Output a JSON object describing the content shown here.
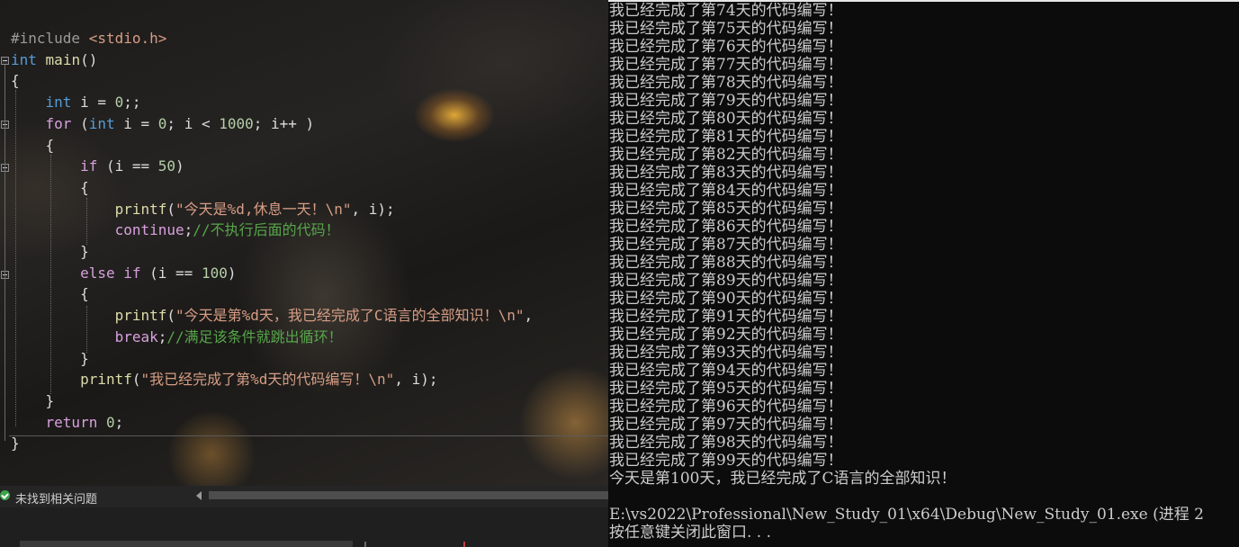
{
  "editor": {
    "lines": [
      [
        {
          "t": "#include ",
          "c": "pp"
        },
        {
          "t": "<stdio.h>",
          "c": "str"
        }
      ],
      [
        {
          "t": "int",
          "c": "kw"
        },
        {
          "t": " ",
          "c": "pl"
        },
        {
          "t": "main",
          "c": "fn"
        },
        {
          "t": "()",
          "c": "pl"
        }
      ],
      [
        {
          "t": "{",
          "c": "pl"
        }
      ],
      [
        {
          "t": "    ",
          "c": "pl"
        },
        {
          "t": "int",
          "c": "kw"
        },
        {
          "t": " i = ",
          "c": "pl"
        },
        {
          "t": "0",
          "c": "num"
        },
        {
          "t": ";;",
          "c": "pl"
        }
      ],
      [
        {
          "t": "    ",
          "c": "pl"
        },
        {
          "t": "for",
          "c": "ctl"
        },
        {
          "t": " (",
          "c": "pl"
        },
        {
          "t": "int",
          "c": "kw"
        },
        {
          "t": " i = ",
          "c": "pl"
        },
        {
          "t": "0",
          "c": "num"
        },
        {
          "t": "; i < ",
          "c": "pl"
        },
        {
          "t": "1000",
          "c": "num"
        },
        {
          "t": "; i++ )",
          "c": "pl"
        }
      ],
      [
        {
          "t": "    {",
          "c": "pl"
        }
      ],
      [
        {
          "t": "        ",
          "c": "pl"
        },
        {
          "t": "if",
          "c": "ctl"
        },
        {
          "t": " (i == ",
          "c": "pl"
        },
        {
          "t": "50",
          "c": "num"
        },
        {
          "t": ")",
          "c": "pl"
        }
      ],
      [
        {
          "t": "        {",
          "c": "pl"
        }
      ],
      [
        {
          "t": "            ",
          "c": "pl"
        },
        {
          "t": "printf",
          "c": "fn"
        },
        {
          "t": "(",
          "c": "pl"
        },
        {
          "t": "\"今天是%d,休息一天！\\n\"",
          "c": "str"
        },
        {
          "t": ", i);",
          "c": "pl"
        }
      ],
      [
        {
          "t": "            ",
          "c": "pl"
        },
        {
          "t": "continue",
          "c": "ctl"
        },
        {
          "t": ";",
          "c": "pl"
        },
        {
          "t": "//不执行后面的代码！",
          "c": "cm"
        }
      ],
      [
        {
          "t": "        }",
          "c": "pl"
        }
      ],
      [
        {
          "t": "        ",
          "c": "pl"
        },
        {
          "t": "else if",
          "c": "ctl"
        },
        {
          "t": " (i == ",
          "c": "pl"
        },
        {
          "t": "100",
          "c": "num"
        },
        {
          "t": ")",
          "c": "pl"
        }
      ],
      [
        {
          "t": "        {",
          "c": "pl"
        }
      ],
      [
        {
          "t": "            ",
          "c": "pl"
        },
        {
          "t": "printf",
          "c": "fn"
        },
        {
          "t": "(",
          "c": "pl"
        },
        {
          "t": "\"今天是第%d天，我已经完成了C语言的全部知识！\\n\"",
          "c": "str"
        },
        {
          "t": ",",
          "c": "pl"
        }
      ],
      [
        {
          "t": "            ",
          "c": "pl"
        },
        {
          "t": "break",
          "c": "ctl"
        },
        {
          "t": ";",
          "c": "pl"
        },
        {
          "t": "//满足该条件就跳出循环！",
          "c": "cm"
        }
      ],
      [
        {
          "t": "        }",
          "c": "pl"
        }
      ],
      [
        {
          "t": "        ",
          "c": "pl"
        },
        {
          "t": "printf",
          "c": "fn"
        },
        {
          "t": "(",
          "c": "pl"
        },
        {
          "t": "\"我已经完成了第%d天的代码编写！\\n\"",
          "c": "str"
        },
        {
          "t": ", i);",
          "c": "pl"
        }
      ],
      [
        {
          "t": "    }",
          "c": "pl"
        }
      ],
      [
        {
          "t": "    ",
          "c": "pl"
        },
        {
          "t": "return",
          "c": "ctl"
        },
        {
          "t": " ",
          "c": "pl"
        },
        {
          "t": "0",
          "c": "num"
        },
        {
          "t": ";",
          "c": "pl"
        }
      ],
      [
        {
          "t": "}",
          "c": "pl"
        }
      ]
    ]
  },
  "status_bar": {
    "message": "未找到相关问题",
    "status_icon": "check-circle-icon",
    "status_color": "#3fa34d"
  },
  "console": {
    "lines": [
      "我已经完成了第74天的代码编写！",
      "我已经完成了第75天的代码编写！",
      "我已经完成了第76天的代码编写！",
      "我已经完成了第77天的代码编写！",
      "我已经完成了第78天的代码编写！",
      "我已经完成了第79天的代码编写！",
      "我已经完成了第80天的代码编写！",
      "我已经完成了第81天的代码编写！",
      "我已经完成了第82天的代码编写！",
      "我已经完成了第83天的代码编写！",
      "我已经完成了第84天的代码编写！",
      "我已经完成了第85天的代码编写！",
      "我已经完成了第86天的代码编写！",
      "我已经完成了第87天的代码编写！",
      "我已经完成了第88天的代码编写！",
      "我已经完成了第89天的代码编写！",
      "我已经完成了第90天的代码编写！",
      "我已经完成了第91天的代码编写！",
      "我已经完成了第92天的代码编写！",
      "我已经完成了第93天的代码编写！",
      "我已经完成了第94天的代码编写！",
      "我已经完成了第95天的代码编写！",
      "我已经完成了第96天的代码编写！",
      "我已经完成了第97天的代码编写！",
      "我已经完成了第98天的代码编写！",
      "我已经完成了第99天的代码编写！",
      "今天是第100天，我已经完成了C语言的全部知识！",
      "",
      "E:\\vs2022\\Professional\\New_Study_01\\x64\\Debug\\New_Study_01.exe (进程 2",
      "按任意键关闭此窗口. . ."
    ]
  }
}
